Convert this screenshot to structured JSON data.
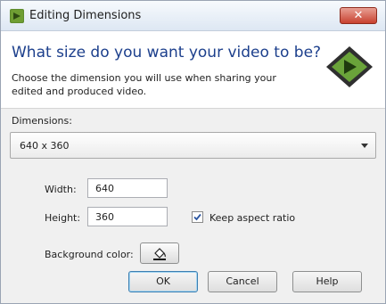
{
  "window": {
    "title": "Editing Dimensions",
    "close_label": "✕",
    "app_icon": "camtasia-app-icon"
  },
  "header": {
    "heading": "What size do you want your video to be?",
    "description": "Choose the dimension you will use when sharing your edited and produced video.",
    "logo_icon": "camtasia-logo-icon"
  },
  "dimensions": {
    "label": "Dimensions:",
    "selected": "640 x 360"
  },
  "width": {
    "label": "Width:",
    "value": "640"
  },
  "height": {
    "label": "Height:",
    "value": "360"
  },
  "aspect": {
    "label": "Keep aspect ratio",
    "checked": true
  },
  "background": {
    "label": "Background color:",
    "icon": "paint-bucket-icon"
  },
  "buttons": {
    "ok": "OK",
    "cancel": "Cancel",
    "help": "Help"
  },
  "colors": {
    "heading": "#1c3f8c",
    "close": "#c8412f",
    "default_border": "#3c7fb1"
  }
}
